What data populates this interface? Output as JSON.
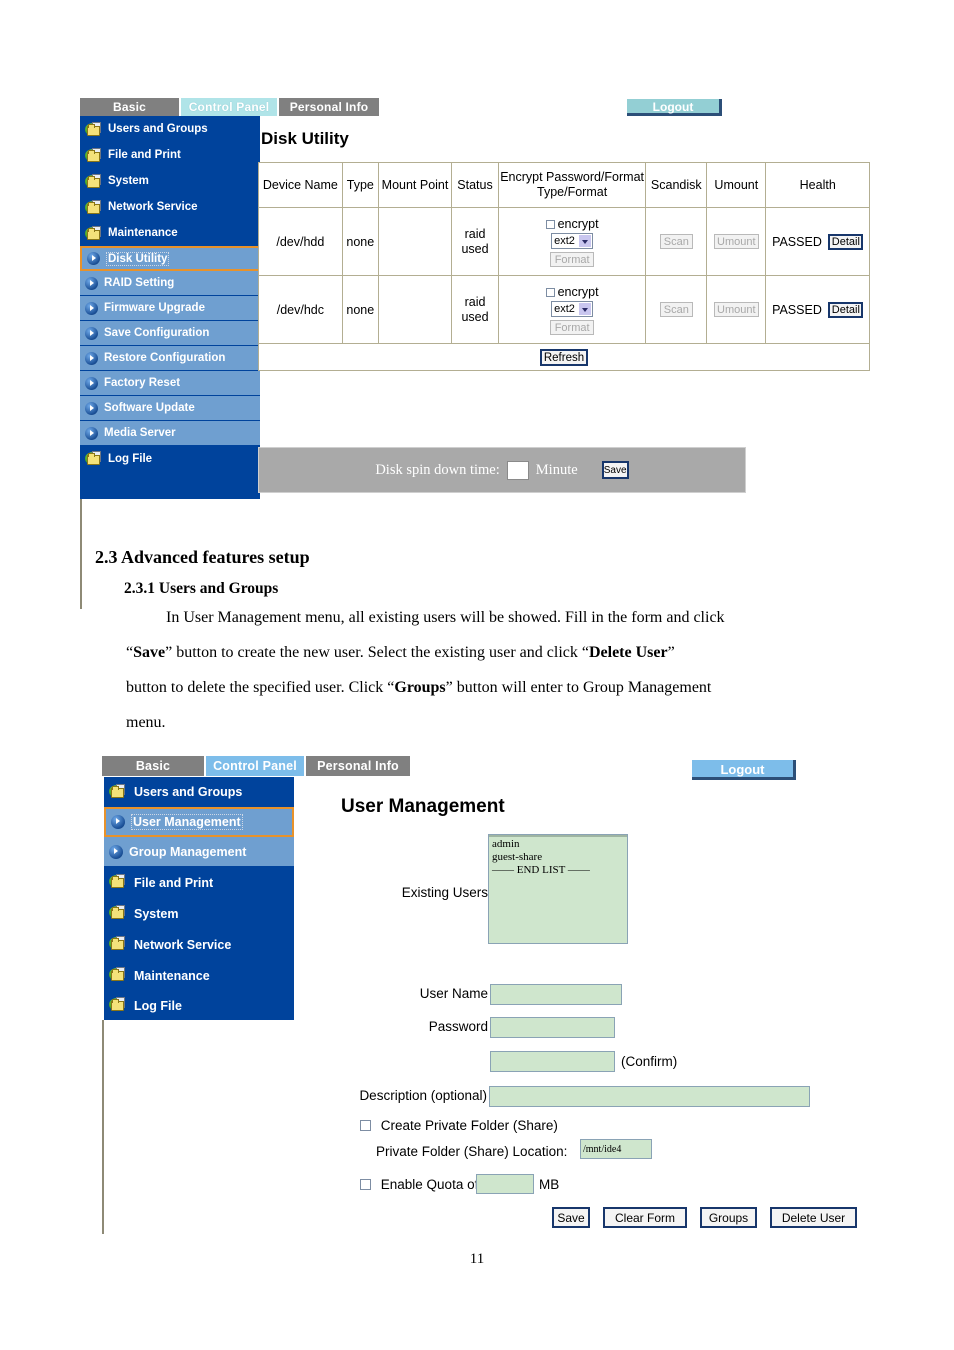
{
  "document": {
    "page_number": "11",
    "heading_2_3": "2.3 Advanced features setup",
    "heading_2_3_1": "2.3.1 Users and Groups",
    "paragraph_line_1": "In User Management menu, all existing users will be showed. Fill in the form and click",
    "paragraph_line_2_a": "“",
    "paragraph_line_2_b": "Save",
    "paragraph_line_2_c": "” button to create the new user. Select the existing user and click “",
    "paragraph_line_2_d": "Delete User",
    "paragraph_line_2_e": "”",
    "paragraph_line_3_a": "button to delete the specified user. Click “",
    "paragraph_line_3_b": "Groups",
    "paragraph_line_3_c": "” button will enter to Group Management",
    "paragraph_line_4": "menu."
  },
  "screenshot_disk_utility": {
    "tabs": [
      {
        "label": "Basic",
        "state": "inactive"
      },
      {
        "label": "Control Panel",
        "state": "active"
      },
      {
        "label": "Personal Info",
        "state": "inactive"
      }
    ],
    "logout_label": "Logout",
    "sidebar": [
      {
        "label": "Users and Groups",
        "icon": "folder-icon",
        "type": "top"
      },
      {
        "label": "File and Print",
        "icon": "folder-icon",
        "type": "top"
      },
      {
        "label": "System",
        "icon": "folder-icon",
        "type": "top"
      },
      {
        "label": "Network Service",
        "icon": "folder-icon",
        "type": "top"
      },
      {
        "label": "Maintenance",
        "icon": "folder-icon",
        "type": "top"
      },
      {
        "label": "Disk Utility",
        "icon": "arrow-icon",
        "type": "selected"
      },
      {
        "label": "RAID Setting",
        "icon": "arrow-icon",
        "type": "sub"
      },
      {
        "label": "Firmware Upgrade",
        "icon": "arrow-icon",
        "type": "sub"
      },
      {
        "label": "Save Configuration",
        "icon": "arrow-icon",
        "type": "sub"
      },
      {
        "label": "Restore Configuration",
        "icon": "arrow-icon",
        "type": "sub"
      },
      {
        "label": "Factory Reset",
        "icon": "arrow-icon",
        "type": "sub"
      },
      {
        "label": "Software Update",
        "icon": "arrow-icon",
        "type": "sub"
      },
      {
        "label": "Media Server",
        "icon": "arrow-icon",
        "type": "sub"
      },
      {
        "label": "Log File",
        "icon": "folder-icon",
        "type": "top"
      }
    ],
    "panel_title": "Disk Utility",
    "table": {
      "headers": [
        "Device Name",
        "Type",
        "Mount Point",
        "Status",
        "Encrypt Password/Format Type/Format",
        "Scandisk",
        "Umount",
        "Health"
      ],
      "header_encrypt_line1": "Encrypt Password/Format",
      "header_encrypt_line2": "Type/Format",
      "rows": [
        {
          "device_name": "/dev/hdd",
          "type": "none",
          "mount_point": "",
          "status_line1": "raid",
          "status_line2": "used",
          "encrypt_checkbox_label": "encrypt",
          "encrypt_checked": false,
          "format_type": "ext2",
          "format_button": "Format",
          "scandisk_button": "Scan",
          "umount_button": "Umount",
          "health": "PASSED",
          "detail_button": "Detail"
        },
        {
          "device_name": "/dev/hdc",
          "type": "none",
          "mount_point": "",
          "status_line1": "raid",
          "status_line2": "used",
          "encrypt_checkbox_label": "encrypt",
          "encrypt_checked": false,
          "format_type": "ext2",
          "format_button": "Format",
          "scandisk_button": "Scan",
          "umount_button": "Umount",
          "health": "PASSED",
          "detail_button": "Detail"
        }
      ],
      "refresh_button": "Refresh"
    },
    "spin_down": {
      "label": "Disk spin down time:",
      "value": "",
      "unit": "Minute",
      "save_button": "Save"
    }
  },
  "screenshot_user_management": {
    "tabs": [
      {
        "label": "Basic",
        "state": "inactive"
      },
      {
        "label": "Control Panel",
        "state": "active"
      },
      {
        "label": "Personal Info",
        "state": "inactive"
      }
    ],
    "logout_label": "Logout",
    "sidebar": [
      {
        "label": "Users and Groups",
        "icon": "folder-icon",
        "type": "top"
      },
      {
        "label": "User Management",
        "icon": "arrow-icon",
        "type": "selected"
      },
      {
        "label": "Group Management",
        "icon": "arrow-icon",
        "type": "sub"
      },
      {
        "label": "File and Print",
        "icon": "folder-icon",
        "type": "top"
      },
      {
        "label": "System",
        "icon": "folder-icon",
        "type": "top"
      },
      {
        "label": "Network Service",
        "icon": "folder-icon",
        "type": "top"
      },
      {
        "label": "Maintenance",
        "icon": "folder-icon",
        "type": "top"
      },
      {
        "label": "Log File",
        "icon": "folder-icon",
        "type": "top"
      }
    ],
    "panel_title": "User Management",
    "form": {
      "existing_users_label": "Existing Users",
      "existing_users": [
        "admin",
        "guest-share",
        "—— END LIST ——"
      ],
      "user_name_label": "User Name",
      "user_name_value": "",
      "password_label": "Password",
      "password_value": "",
      "confirm_value": "",
      "confirm_label": "(Confirm)",
      "description_label": "Description (optional)",
      "description_value": "",
      "create_private_folder_label": "Create Private Folder (Share)",
      "create_private_folder_checked": false,
      "private_folder_location_label": "Private Folder (Share) Location:",
      "private_folder_location_value": "/mnt/ide4",
      "enable_quota_label": "Enable Quota of",
      "enable_quota_checked": false,
      "quota_value": "",
      "quota_unit": "MB",
      "buttons": [
        "Save",
        "Clear Form",
        "Groups",
        "Delete User"
      ]
    }
  },
  "colors": {
    "sidebar_blue": "#00439c",
    "sub_item_blue": "#6f9fd0",
    "tab_grey": "#808080",
    "tab_active_teal": "#b0e4e8",
    "tab_active_blue": "#7dbdea",
    "selection_orange": "#e8922a",
    "input_green": "#cfe6cd",
    "grey_bar": "#a9a9a9"
  }
}
